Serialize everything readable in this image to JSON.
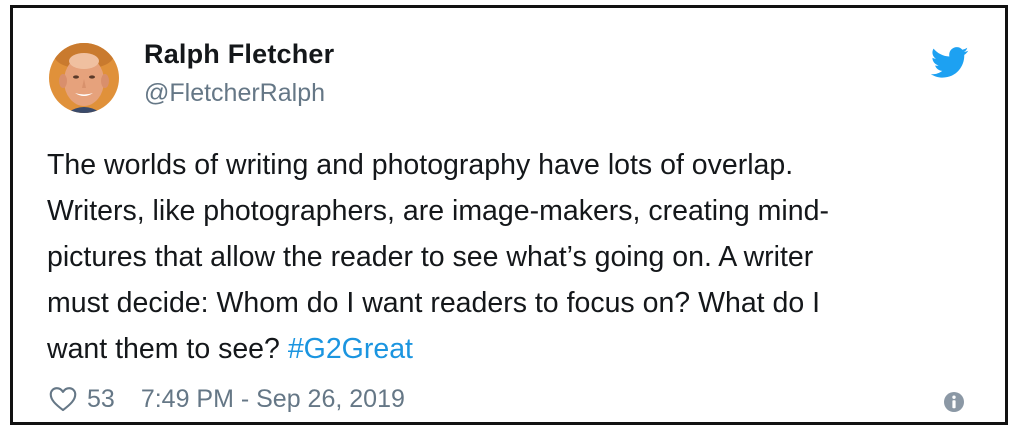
{
  "tweet": {
    "author_name": "Ralph Fletcher",
    "author_handle": "@FletcherRalph",
    "text_lines": [
      "The worlds of writing and photography have lots of overlap.",
      "Writers, like photographers, are image-makers, creating mind-",
      "pictures that allow the reader to see what’s going on. A writer",
      "must decide: Whom do I want readers to focus on? What do I",
      "want them to see? "
    ],
    "hashtag": "#G2Great",
    "likes": "53",
    "timestamp": "7:49 PM - Sep 26, 2019"
  },
  "icons": {
    "logo": "twitter-bird-icon",
    "like": "heart-icon",
    "info": "info-icon"
  },
  "colors": {
    "brand": "#1da1f2",
    "hashtag": "#1b95e0",
    "text": "#14171a",
    "secondary": "#657786",
    "border": "#111111"
  }
}
